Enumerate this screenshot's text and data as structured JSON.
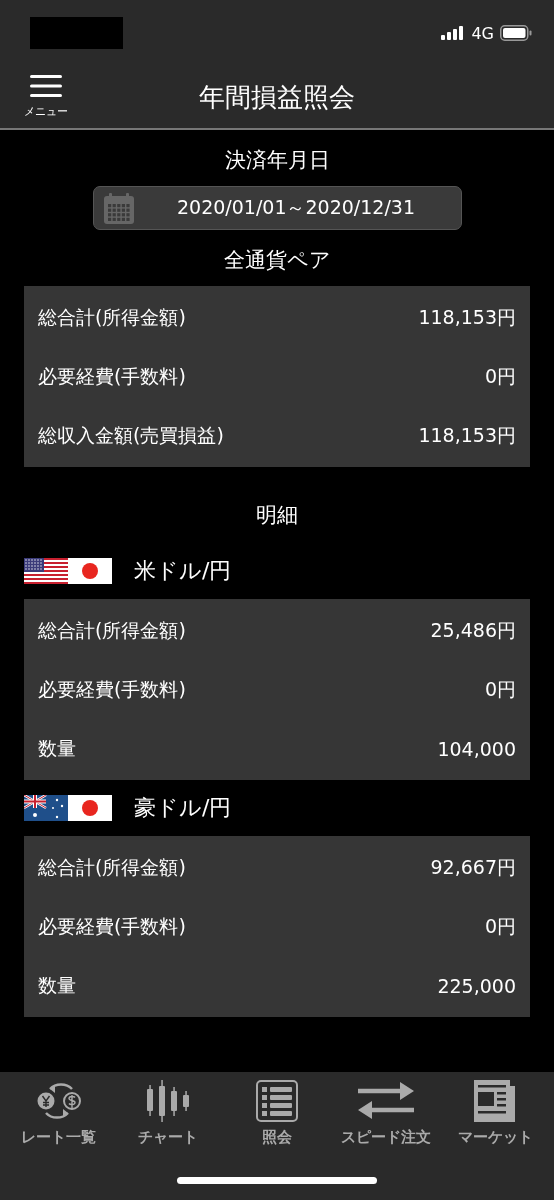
{
  "status_bar": {
    "network": "4G"
  },
  "header": {
    "menu_label": "メニュー",
    "title": "年間損益照会"
  },
  "period": {
    "label": "決済年月日",
    "value": "2020/01/01～2020/12/31"
  },
  "total": {
    "title": "全通貨ペア",
    "rows": [
      {
        "label": "総合計(所得金額)",
        "value": "118,153円"
      },
      {
        "label": "必要経費(手数料)",
        "value": "0円"
      },
      {
        "label": "総収入金額(売買損益)",
        "value": "118,153円"
      }
    ]
  },
  "details": {
    "title": "明細",
    "pairs": [
      {
        "kind": "us",
        "name": "米ドル/円",
        "rows": [
          {
            "label": "総合計(所得金額)",
            "value": "25,486円"
          },
          {
            "label": "必要経費(手数料)",
            "value": "0円"
          },
          {
            "label": "数量",
            "value": "104,000"
          }
        ]
      },
      {
        "kind": "au",
        "name": "豪ドル/円",
        "rows": [
          {
            "label": "総合計(所得金額)",
            "value": "92,667円"
          },
          {
            "label": "必要経費(手数料)",
            "value": "0円"
          },
          {
            "label": "数量",
            "value": "225,000"
          }
        ]
      }
    ]
  },
  "tab_bar": [
    {
      "kind": "rates",
      "label": "レート一覧"
    },
    {
      "kind": "chart",
      "label": "チャート"
    },
    {
      "kind": "inquiry",
      "label": "照会"
    },
    {
      "kind": "speed",
      "label": "スピード注文"
    },
    {
      "kind": "market",
      "label": "マーケット"
    }
  ]
}
